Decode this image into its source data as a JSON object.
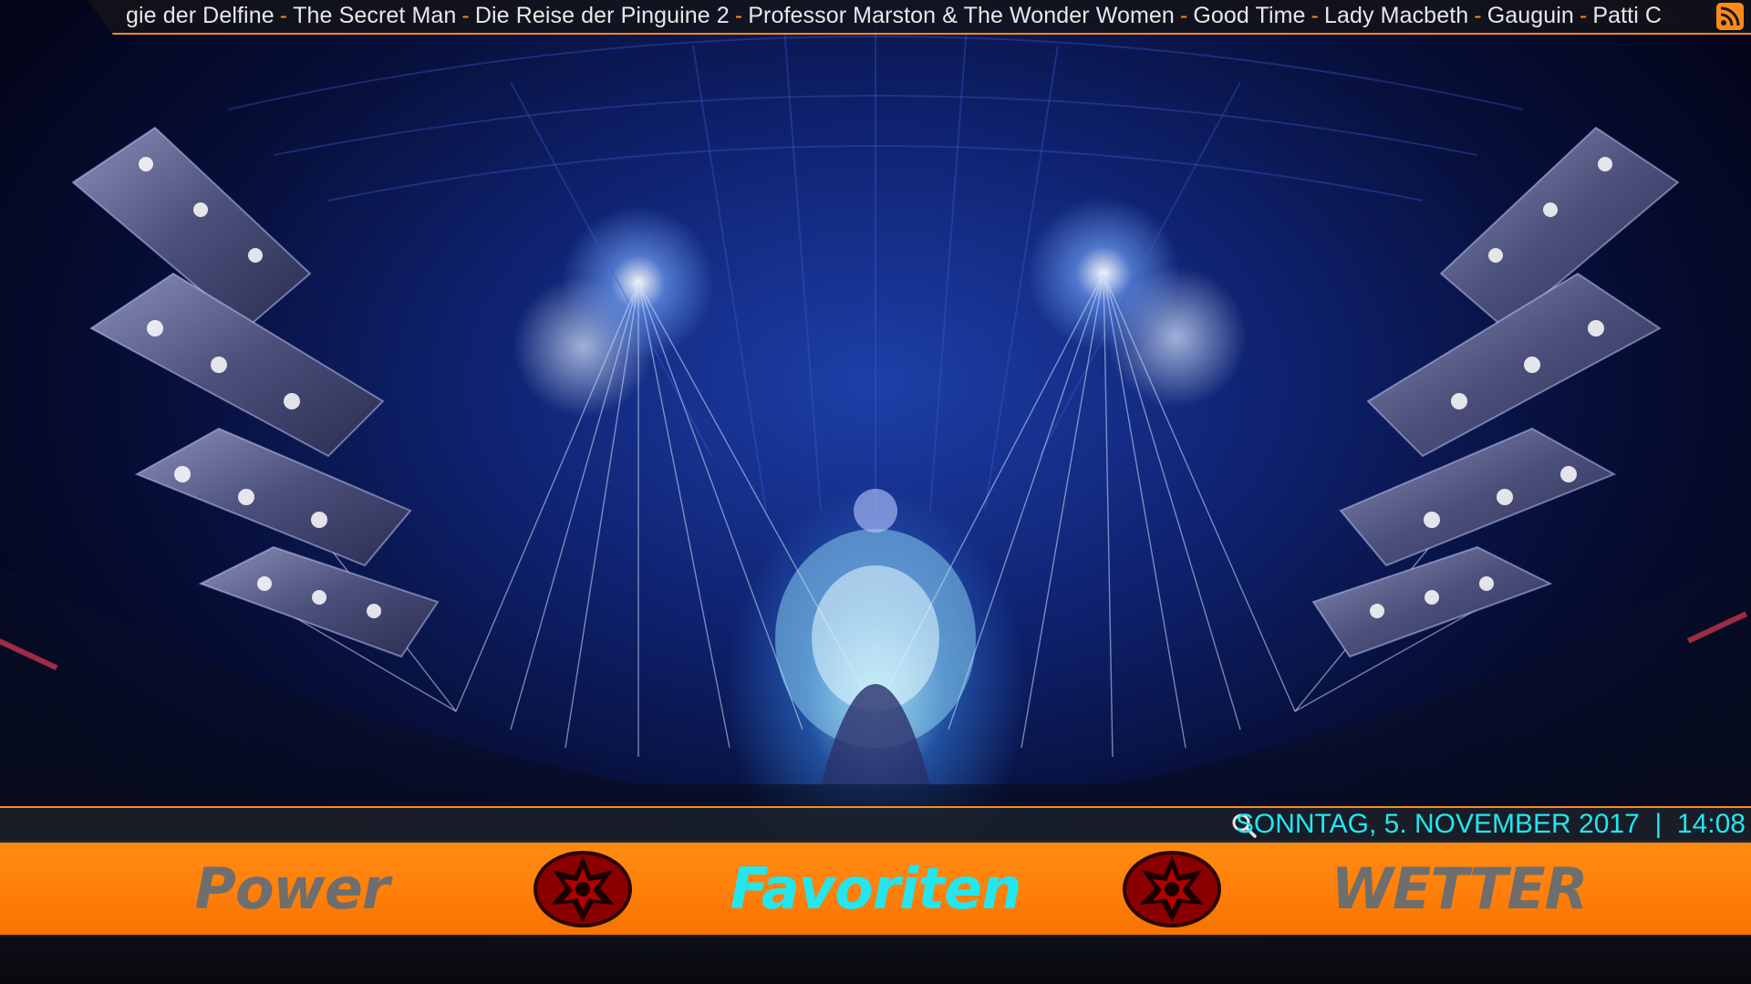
{
  "ticker": {
    "items": [
      "gie der Delfine",
      "The Secret Man",
      "Die Reise der Pinguine 2",
      "Professor Marston & The Wonder Women",
      "Good Time",
      "Lady Macbeth",
      "Gauguin",
      "Patti C"
    ],
    "separator": "-",
    "icon": "rss-icon"
  },
  "infobar": {
    "search_icon": "search-icon",
    "datetime": "SONNTAG, 5. NOVEMBER 2017  |  14:08"
  },
  "menu": {
    "items": [
      {
        "label": "Power",
        "state": "inactive"
      },
      {
        "label": "Favoriten",
        "state": "active"
      },
      {
        "label": "WETTER",
        "state": "inactive"
      }
    ],
    "separator_icon": "emblem-icon"
  },
  "colors": {
    "accent": "#ff8a1c",
    "active_text": "#23e6ee",
    "inactive_text": "#6e6e6e",
    "emblem_fill": "#8a0000"
  }
}
